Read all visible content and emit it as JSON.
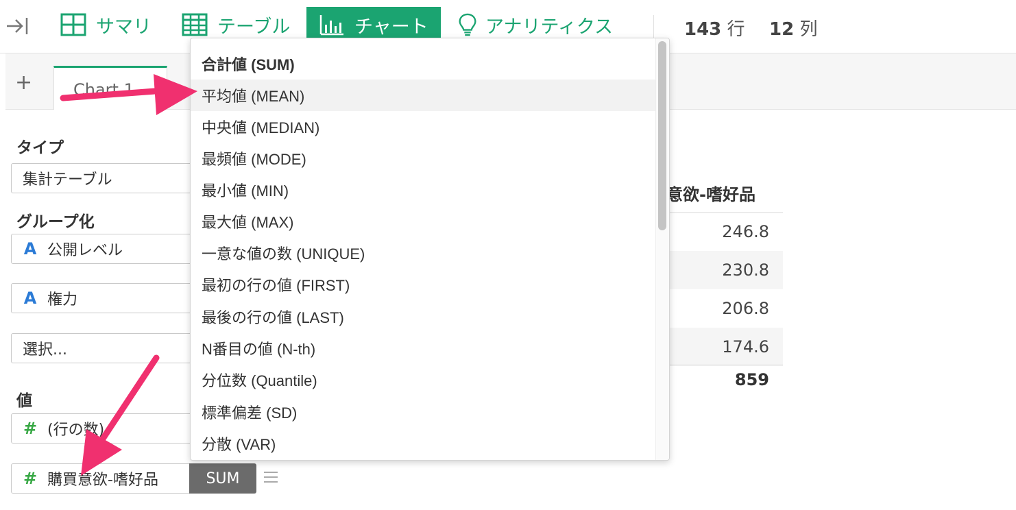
{
  "toolbar": {
    "tabs": [
      {
        "label": "サマリ",
        "icon": "summary-grid-icon"
      },
      {
        "label": "テーブル",
        "icon": "table-icon"
      },
      {
        "label": "チャート",
        "icon": "bar-chart-icon"
      },
      {
        "label": "アナリティクス",
        "icon": "lightbulb-icon"
      }
    ],
    "active_tab": "チャート",
    "rows_count": "143",
    "rows_unit": "行",
    "cols_count": "12",
    "cols_unit": "列"
  },
  "chart_tabs": {
    "add_label": "+",
    "current": "Chart 1"
  },
  "config": {
    "type_label": "タイプ",
    "type_value": "集計テーブル",
    "group_label": "グループ化",
    "group_fields": [
      {
        "type_icon": "A",
        "name": "公開レベル"
      },
      {
        "type_icon": "A",
        "name": "権力"
      }
    ],
    "group_placeholder": "選択...",
    "value_label": "値",
    "value_fields": [
      {
        "type_icon": "#",
        "name": "(行の数)"
      },
      {
        "type_icon": "#",
        "name": "購買意欲-嗜好品",
        "agg": "SUM"
      }
    ]
  },
  "result_table": {
    "header": "意欲-嗜好品",
    "values": [
      "246.8",
      "230.8",
      "206.8",
      "174.6"
    ],
    "total": "859"
  },
  "dropdown": {
    "options": [
      "合計値 (SUM)",
      "平均値 (MEAN)",
      "中央値 (MEDIAN)",
      "最頻値 (MODE)",
      "最小値 (MIN)",
      "最大値 (MAX)",
      "一意な値の数 (UNIQUE)",
      "最初の行の値 (FIRST)",
      "最後の行の値 (LAST)",
      "N番目の値 (N-th)",
      "分位数 (Quantile)",
      "標準偏差 (SD)",
      "分散 (VAR)"
    ],
    "selected": "合計値 (SUM)",
    "highlighted": "平均値 (MEAN)"
  },
  "colors": {
    "accent": "#1ba471",
    "annotation_arrow": "#f0306f",
    "field_type_text": "#2b7bd6",
    "field_type_number": "#38a845"
  }
}
